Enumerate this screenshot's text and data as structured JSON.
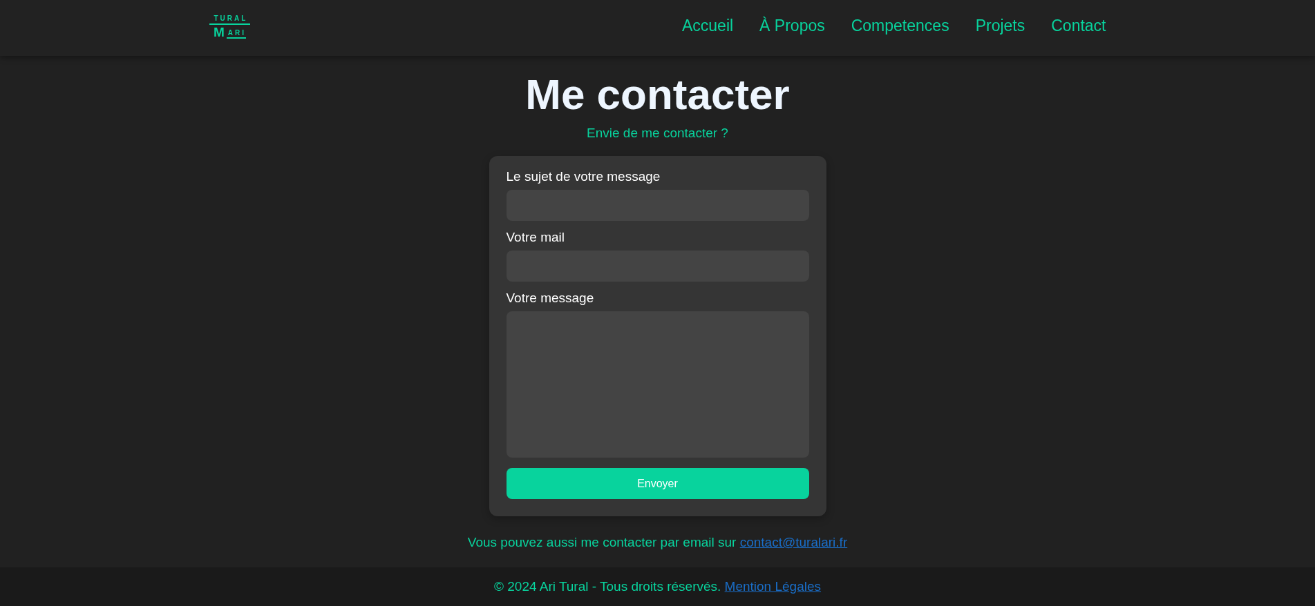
{
  "header": {
    "logo": {
      "top": "TURAL",
      "initial": "M",
      "rest": "ARI"
    },
    "nav": [
      {
        "label": "Accueil"
      },
      {
        "label": "À Propos"
      },
      {
        "label": "Competences"
      },
      {
        "label": "Projets"
      },
      {
        "label": "Contact"
      }
    ]
  },
  "title": "Me contacter",
  "subtitle": "Envie de me contacter ?",
  "form": {
    "fields": [
      {
        "label": "Le sujet de votre message",
        "kind": "input"
      },
      {
        "label": "Votre mail",
        "kind": "input"
      },
      {
        "label": "Votre message",
        "kind": "textarea"
      }
    ],
    "button": "Envoyer"
  },
  "email_note": {
    "text": "Vous pouvez aussi me contacter par email sur",
    "link": "contact@turalari.fr"
  },
  "footer": {
    "text": "© 2024 Ari Tural - Tous droits réservés.",
    "link": "Mention Légales"
  }
}
